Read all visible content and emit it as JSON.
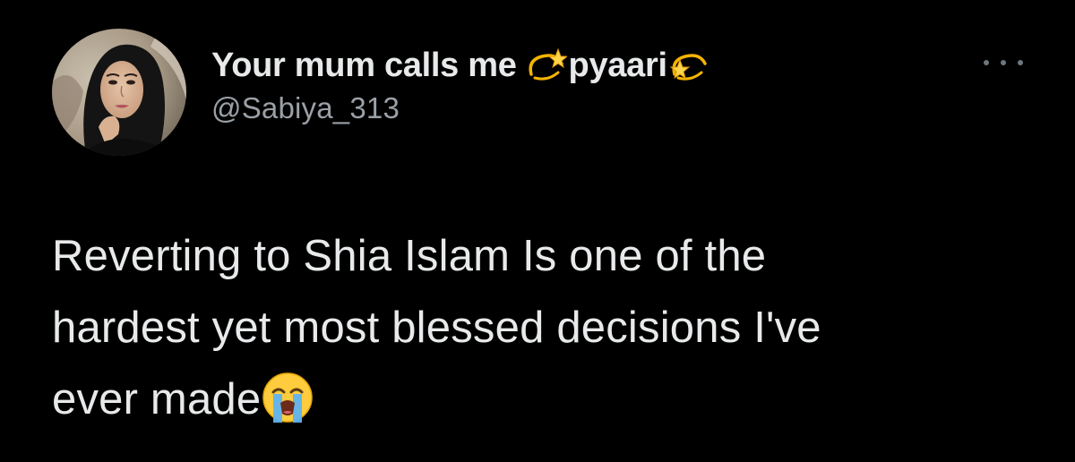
{
  "tweet": {
    "author": {
      "display_name": "Your mum calls me",
      "display_name_suffix": "pyaari",
      "name_emoji_icon": "dizzy-star-emoji",
      "handle": "@Sabiya_313"
    },
    "text_lines": [
      "Reverting to Shia Islam Is one of the",
      "hardest yet most blessed decisions I've",
      "ever made"
    ],
    "trailing_emoji_icon": "loudly-crying-face-emoji",
    "more_menu_icon": "more-horizontal-icon"
  },
  "colors": {
    "background": "#000000",
    "primary_text": "#e7e9ea",
    "secondary_text": "#9aa0a6"
  }
}
